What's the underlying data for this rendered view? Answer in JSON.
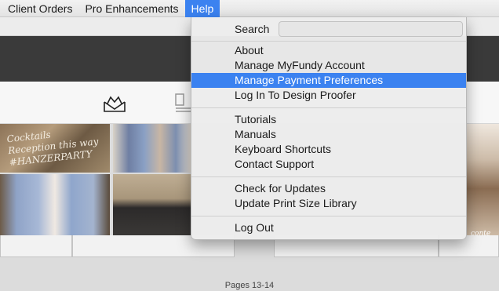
{
  "menubar": {
    "items": [
      "Client Orders",
      "Pro Enhancements",
      "Help"
    ]
  },
  "help_menu": {
    "search_label": "Search",
    "search_value": "",
    "groups": [
      [
        "About",
        "Manage MyFundy Account",
        "Manage Payment Preferences",
        "Log In To Design Proofer"
      ],
      [
        "Tutorials",
        "Manuals",
        "Keyboard Shortcuts",
        "Contact Support"
      ],
      [
        "Check for Updates",
        "Update Print Size Library"
      ],
      [
        "Log Out"
      ]
    ],
    "highlighted": "Manage Payment Preferences"
  },
  "toolbar": {
    "icons": [
      "album-icon",
      "layout-icon"
    ]
  },
  "photos": {
    "sign_text": [
      "Cocktails",
      "Reception this way",
      "#HANZERPARTY"
    ],
    "right_text": "conte"
  },
  "footer": {
    "pages_label": "Pages 13-14"
  },
  "colors": {
    "highlight": "#3b82f0",
    "dark_toolbar": "#3a3a3a"
  }
}
